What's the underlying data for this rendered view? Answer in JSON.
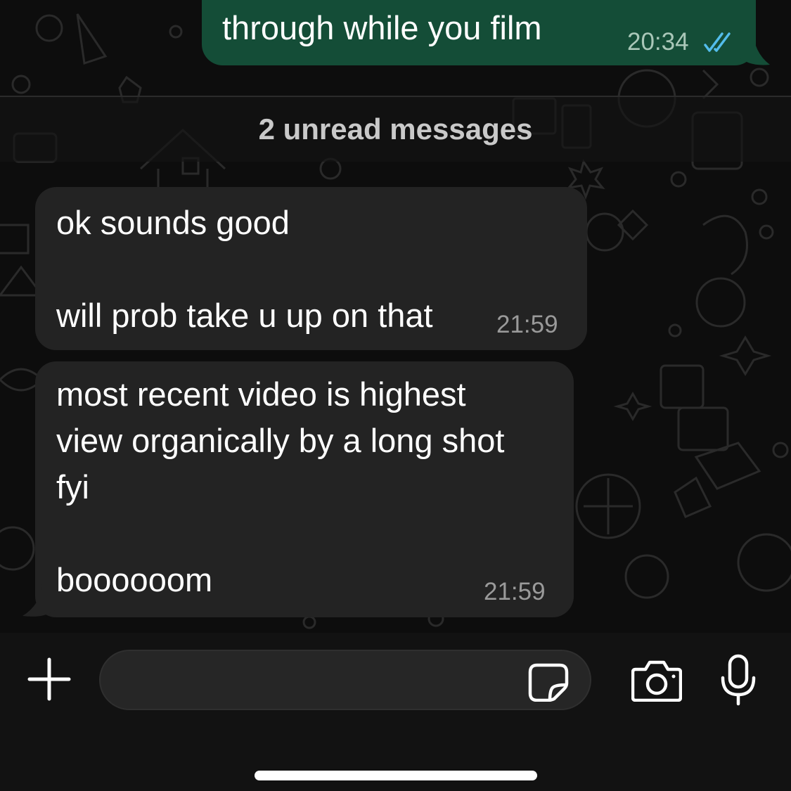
{
  "chat": {
    "outgoing": {
      "text": "through while you film",
      "time": "20:34",
      "status_icon": "read-double-check-icon",
      "bubble_color": "#144d37",
      "tick_color": "#53bdeb"
    },
    "unread_divider": {
      "label": "2 unread messages"
    },
    "incoming": [
      {
        "lines": [
          "ok sounds good",
          "",
          "will prob take u up on that"
        ],
        "time": "21:59"
      },
      {
        "lines": [
          "most recent video is highest",
          "view organically by a long shot",
          "fyi",
          "",
          "boooooom"
        ],
        "time": "21:59"
      }
    ],
    "incoming_bubble_color": "#232323"
  },
  "composer": {
    "message_value": "",
    "icons": {
      "attach": "plus-icon",
      "sticker": "sticker-icon",
      "camera": "camera-icon",
      "mic": "microphone-icon"
    }
  }
}
